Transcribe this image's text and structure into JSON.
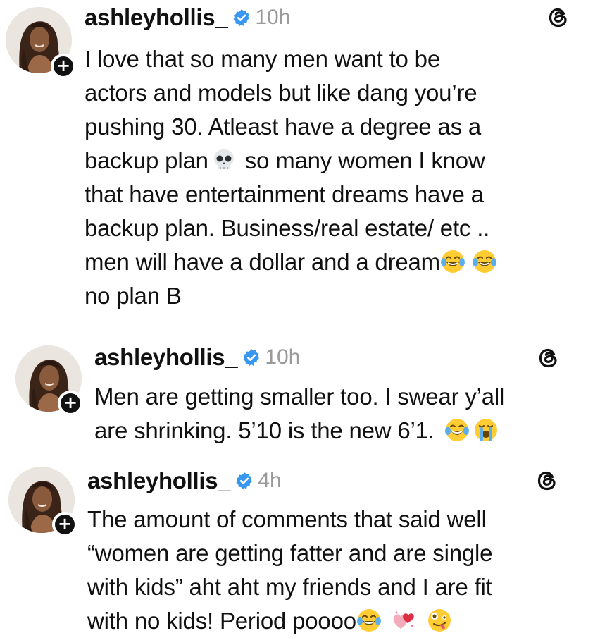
{
  "posts": [
    {
      "username": "ashleyhollis_",
      "time": "10h",
      "text_lines": [
        "I love that so many men want to be",
        "actors and models but like dang you’re",
        "pushing 30. Atleast have a degree as a",
        "backup plan",
        "so many women I know",
        "that have entertainment dreams have a",
        "backup plan. Business/real estate/ etc ..",
        "men will have a dollar and a dream",
        "no plan B"
      ],
      "emojis": [
        "skull",
        "joy",
        "joy"
      ]
    },
    {
      "username": "ashleyhollis_",
      "time": "10h",
      "text_lines": [
        "Men are getting smaller too. I swear y’all",
        "are shrinking. 5’10 is the new 6’1."
      ],
      "emojis": [
        "joy",
        "sob"
      ]
    },
    {
      "username": "ashleyhollis_",
      "time": "4h",
      "text_lines": [
        "The amount of comments that said well",
        "“women are getting fatter and are single",
        "with kids” aht aht my friends and I are fit",
        "with no kids! Period poooo"
      ],
      "emojis": [
        "joy",
        "two-hearts",
        "zany-face"
      ]
    }
  ],
  "icons": {
    "verified": "verified-badge-icon",
    "threads": "threads-logo-icon",
    "follow": "plus-icon"
  },
  "colors": {
    "text": "#111111",
    "timestamp": "#9a9a9a",
    "verified": "#3897f0"
  }
}
